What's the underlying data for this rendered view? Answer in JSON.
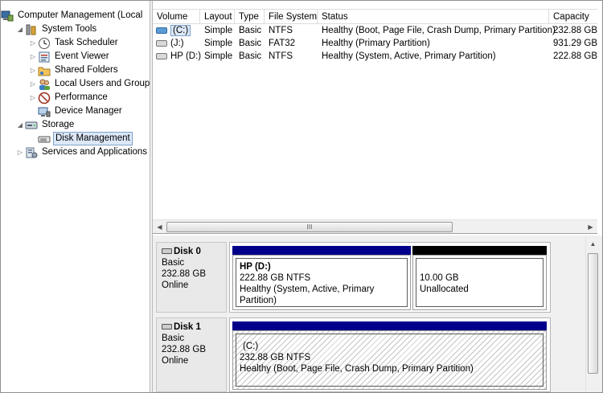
{
  "tree": {
    "root": "Computer Management (Local",
    "system_tools": "System Tools",
    "task_scheduler": "Task Scheduler",
    "event_viewer": "Event Viewer",
    "shared_folders": "Shared Folders",
    "local_users": "Local Users and Groups",
    "performance": "Performance",
    "device_manager": "Device Manager",
    "storage": "Storage",
    "disk_management": "Disk Management",
    "services": "Services and Applications"
  },
  "columns": {
    "volume": "Volume",
    "layout": "Layout",
    "type": "Type",
    "filesystem": "File System",
    "status": "Status",
    "capacity": "Capacity"
  },
  "volumes": [
    {
      "volume": "(C:)",
      "layout": "Simple",
      "type": "Basic",
      "filesystem": "NTFS",
      "status": "Healthy (Boot, Page File, Crash Dump, Primary Partition)",
      "capacity": "232.88 GB"
    },
    {
      "volume": "(J:)",
      "layout": "Simple",
      "type": "Basic",
      "filesystem": "FAT32",
      "status": "Healthy (Primary Partition)",
      "capacity": "931.29 GB"
    },
    {
      "volume": "HP (D:)",
      "layout": "Simple",
      "type": "Basic",
      "filesystem": "NTFS",
      "status": "Healthy (System, Active, Primary Partition)",
      "capacity": "222.88 GB"
    }
  ],
  "scroll": {
    "grip": "III"
  },
  "disks": [
    {
      "name": "Disk 0",
      "type": "Basic",
      "size": "232.88 GB",
      "state": "Online",
      "partitions": [
        {
          "title": "HP  (D:)",
          "size": "222.88 GB NTFS",
          "status": "Healthy (System, Active, Primary Partition)"
        },
        {
          "title": "",
          "size": "10.00 GB",
          "status": "Unallocated"
        }
      ]
    },
    {
      "name": "Disk 1",
      "type": "Basic",
      "size": "232.88 GB",
      "state": "Online",
      "partitions": [
        {
          "title": "(C:)",
          "size": "232.88 GB NTFS",
          "status": "Healthy (Boot, Page File, Crash Dump, Primary Partition)"
        }
      ]
    }
  ],
  "colors": {
    "primary_partition": "#00008b",
    "unallocated": "#000000",
    "selection": "#dce8f7"
  }
}
